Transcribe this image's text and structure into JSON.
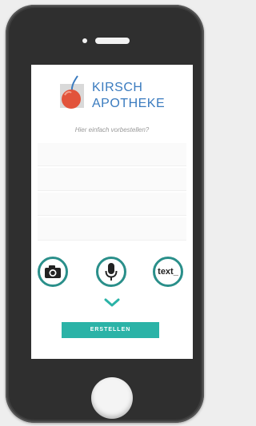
{
  "logo": {
    "line1": "KIRSCH",
    "line2": "APOTHEKE"
  },
  "prompt": "Hier einfach vorbestellen?",
  "actions": {
    "camera_icon": "camera-icon",
    "mic_icon": "microphone-icon",
    "text_label": "text_"
  },
  "create_button": {
    "label": "ERSTELLEN"
  },
  "colors": {
    "brand_blue": "#3a7bbf",
    "teal": "#2bb3a7",
    "icon_ring": "#2a8f8a",
    "cherry": "#e2533b"
  }
}
